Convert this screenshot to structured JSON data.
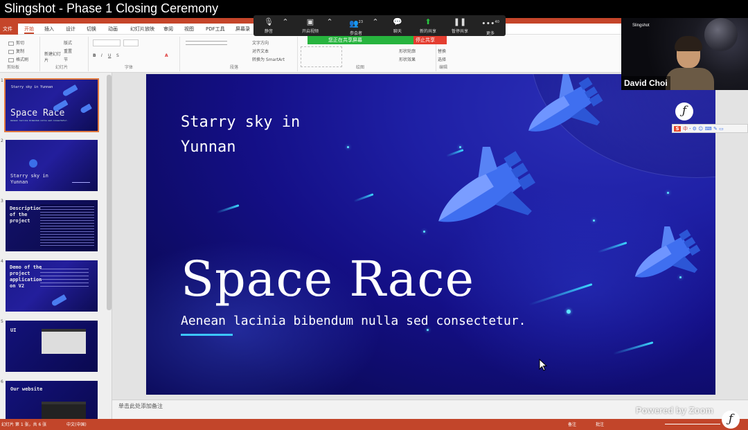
{
  "video_title": "Slingshot - Phase 1 Closing Ceremony",
  "ppt": {
    "tabs": [
      {
        "label": "文件",
        "kind": "file"
      },
      {
        "label": "开始",
        "kind": "active"
      },
      {
        "label": "插入"
      },
      {
        "label": "设计"
      },
      {
        "label": "切换"
      },
      {
        "label": "动画"
      },
      {
        "label": "幻灯片放映"
      },
      {
        "label": "审阅"
      },
      {
        "label": "视图"
      },
      {
        "label": "PDF工具"
      },
      {
        "label": "屏幕录"
      }
    ],
    "ribbon": {
      "clipboard": {
        "cut": "剪切",
        "copy": "复制",
        "format_painter": "格式刷",
        "group_label": "剪贴板"
      },
      "slides": {
        "new_slide": "新建幻灯片",
        "layout": "版式",
        "reset": "重置",
        "section": "节",
        "group_label": "幻灯片"
      },
      "font": {
        "group_label": "字体"
      },
      "paragraph": {
        "text_direction": "文字方向",
        "align_text": "对齐文本",
        "smartart": "转换为 SmartArt",
        "group_label": "段落"
      },
      "drawing": {
        "shape_fill": "形状填充",
        "shape_outline": "形状轮廓",
        "shape_effect": "形状效果",
        "group_label": "绘图"
      },
      "editing": {
        "replace": "替换",
        "select": "选择",
        "group_label": "编辑"
      }
    },
    "notes_placeholder": "单击此处添加备注",
    "status": {
      "slide_info": "幻灯片 第 1 张，共 6 张",
      "language": "中文(中国)",
      "notes": "备注",
      "comments": "批注"
    }
  },
  "zoom": {
    "buttons": [
      {
        "label": "静音",
        "icon": "microphone-icon"
      },
      {
        "label": "开启视频",
        "icon": "video-camera-icon"
      },
      {
        "label": "参会者",
        "icon": "participants-icon",
        "badge": "23"
      },
      {
        "label": "聊天",
        "icon": "chat-icon"
      },
      {
        "label": "新的共享",
        "icon": "share-screen-icon"
      },
      {
        "label": "暂停共享",
        "icon": "pause-icon"
      },
      {
        "label": "更多",
        "icon": "more-icon",
        "badge": "40"
      }
    ],
    "share_banner": "您正在共享屏幕",
    "stop_share": "停止共享",
    "participant_name": "David Choi",
    "background_text": "Slingshot",
    "watermark": "Powered by Zoom"
  },
  "slide": {
    "subtitle_line1": "Starry sky in",
    "subtitle_line2": "Yunnan",
    "title": "Space Race",
    "tagline": "Aenean lacinia bibendum nulla sed consectetur."
  },
  "thumbnails": [
    {
      "num": "1",
      "selected": true,
      "small_top": "Starry sky in Yunnan",
      "big": "Space Race",
      "tag": "Aenean lacinia bibendum nulla sed consectetur."
    },
    {
      "num": "2",
      "text": "Starry sky in\nYunnan"
    },
    {
      "num": "3",
      "text": "Description\nof the\nproject"
    },
    {
      "num": "4",
      "text": "Demo of the\nproject\napplication\non V2"
    },
    {
      "num": "5",
      "text": "UI"
    },
    {
      "num": "6",
      "text": "Our website"
    }
  ],
  "ime": {
    "brand": "S",
    "lang": "中"
  },
  "colors": {
    "accent": "#c5452a",
    "slide_bg": "#1a1a9a",
    "cyan": "#3cd9ff",
    "zoom_bar": "#232323",
    "share_green": "#27b43e",
    "stop_red": "#e43d30"
  }
}
